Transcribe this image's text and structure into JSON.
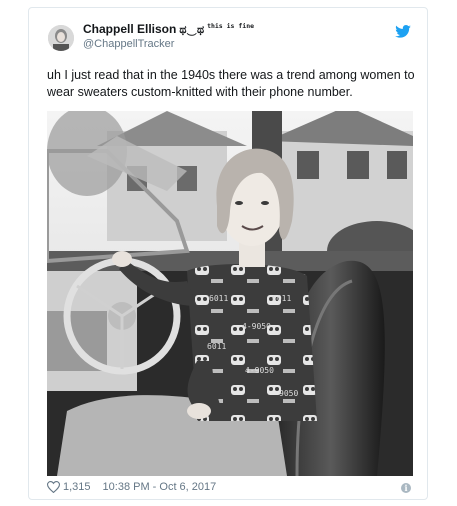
{
  "tweet": {
    "author_name": "Chappell Ellison",
    "name_glyphs": "ಥ‿ಥ",
    "name_tag": "this is fine",
    "handle": "@ChappellTracker",
    "text": "uh I just read that in the 1940s there was a trend among women to wear sweaters custom-knitted with their phone number.",
    "likes": "1,315",
    "timestamp": "10:38 PM - Oct 6, 2017",
    "info_glyph": "i"
  },
  "colors": {
    "brand": "#1da1f2",
    "secondary_text": "#657786",
    "border": "#e1e8ed"
  },
  "photo": {
    "sweater_numbers": [
      "6011",
      "4-9050",
      "6011",
      "4-9050",
      "6011",
      "9050"
    ]
  },
  "icons": {
    "bird": "twitter-bird-icon",
    "heart": "heart-icon",
    "info": "info-icon"
  }
}
